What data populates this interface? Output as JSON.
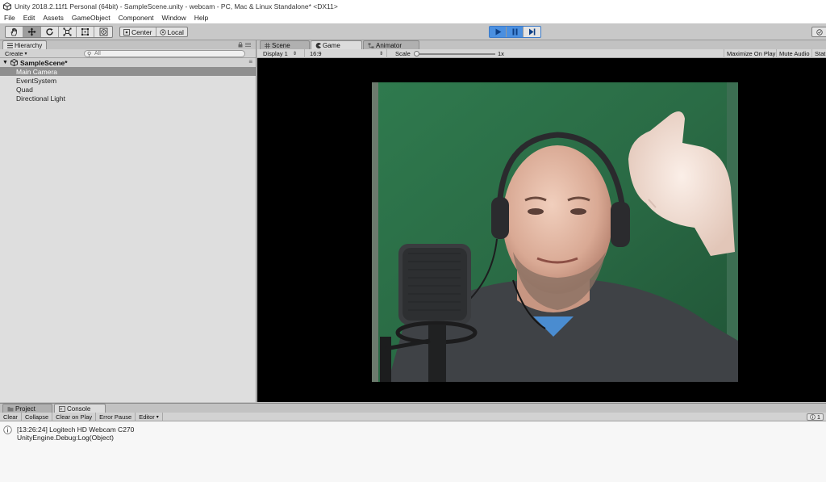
{
  "window": {
    "title": "Unity 2018.2.11f1 Personal (64bit) - SampleScene.unity - webcam - PC, Mac & Linux Standalone* <DX11>"
  },
  "menu": [
    "File",
    "Edit",
    "Assets",
    "GameObject",
    "Component",
    "Window",
    "Help"
  ],
  "toolbar": {
    "tools": [
      "hand-tool",
      "move-tool",
      "rotate-tool",
      "scale-tool",
      "rect-tool",
      "transform-tool"
    ],
    "active_tool": 1,
    "pivot_label": "Center",
    "space_label": "Local"
  },
  "hierarchy": {
    "tab_label": "Hierarchy",
    "create_label": "Create",
    "search_placeholder": "All",
    "scene_name": "SampleScene*",
    "items": [
      "Main Camera",
      "EventSystem",
      "Quad",
      "Directional Light"
    ],
    "selected_index": 0
  },
  "game_panel": {
    "tabs": [
      "Scene",
      "Game",
      "Animator"
    ],
    "active_tab": 1,
    "display": "Display 1",
    "aspect": "16:9",
    "scale_label": "Scale",
    "scale_value": "1x",
    "maximize_label": "Maximize On Play",
    "mute_label": "Mute Audio",
    "stats_label": "Stat"
  },
  "console_panel": {
    "tabs": [
      "Project",
      "Console"
    ],
    "active_tab": 1,
    "buttons": [
      "Clear",
      "Collapse",
      "Clear on Play",
      "Error Pause",
      "Editor"
    ],
    "message_count": "1",
    "log": {
      "line1": "[13:26:24] Logitech HD Webcam C270",
      "line2": "UnityEngine.Debug:Log(Object)"
    }
  },
  "colors": {
    "accent": "#4a8fe0",
    "greenscreen": "#2f6b45",
    "background": "#c2c2c2"
  }
}
